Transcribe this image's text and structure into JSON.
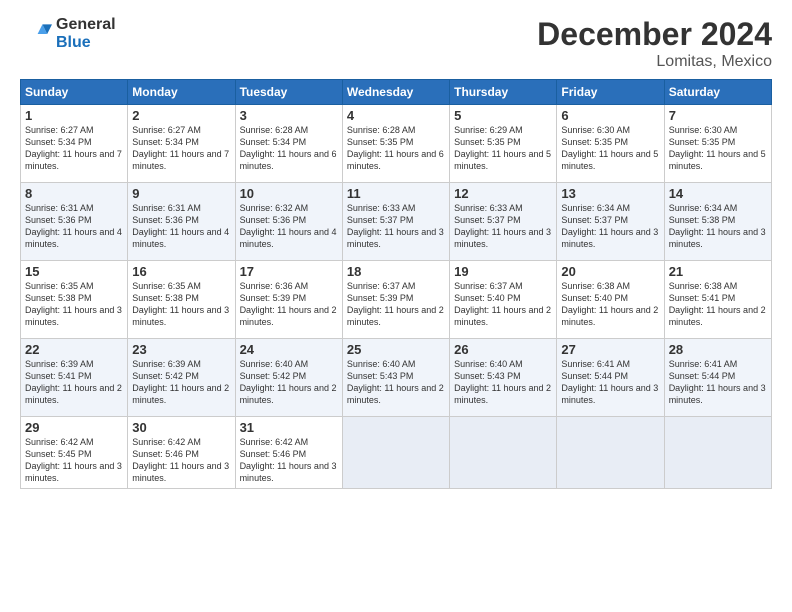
{
  "logo": {
    "general": "General",
    "blue": "Blue"
  },
  "title": "December 2024",
  "subtitle": "Lomitas, Mexico",
  "days_of_week": [
    "Sunday",
    "Monday",
    "Tuesday",
    "Wednesday",
    "Thursday",
    "Friday",
    "Saturday"
  ],
  "weeks": [
    [
      {
        "day": "1",
        "sunrise": "6:27 AM",
        "sunset": "5:34 PM",
        "daylight": "11 hours and 7 minutes."
      },
      {
        "day": "2",
        "sunrise": "6:27 AM",
        "sunset": "5:34 PM",
        "daylight": "11 hours and 7 minutes."
      },
      {
        "day": "3",
        "sunrise": "6:28 AM",
        "sunset": "5:34 PM",
        "daylight": "11 hours and 6 minutes."
      },
      {
        "day": "4",
        "sunrise": "6:28 AM",
        "sunset": "5:35 PM",
        "daylight": "11 hours and 6 minutes."
      },
      {
        "day": "5",
        "sunrise": "6:29 AM",
        "sunset": "5:35 PM",
        "daylight": "11 hours and 5 minutes."
      },
      {
        "day": "6",
        "sunrise": "6:30 AM",
        "sunset": "5:35 PM",
        "daylight": "11 hours and 5 minutes."
      },
      {
        "day": "7",
        "sunrise": "6:30 AM",
        "sunset": "5:35 PM",
        "daylight": "11 hours and 5 minutes."
      }
    ],
    [
      {
        "day": "8",
        "sunrise": "6:31 AM",
        "sunset": "5:36 PM",
        "daylight": "11 hours and 4 minutes."
      },
      {
        "day": "9",
        "sunrise": "6:31 AM",
        "sunset": "5:36 PM",
        "daylight": "11 hours and 4 minutes."
      },
      {
        "day": "10",
        "sunrise": "6:32 AM",
        "sunset": "5:36 PM",
        "daylight": "11 hours and 4 minutes."
      },
      {
        "day": "11",
        "sunrise": "6:33 AM",
        "sunset": "5:37 PM",
        "daylight": "11 hours and 3 minutes."
      },
      {
        "day": "12",
        "sunrise": "6:33 AM",
        "sunset": "5:37 PM",
        "daylight": "11 hours and 3 minutes."
      },
      {
        "day": "13",
        "sunrise": "6:34 AM",
        "sunset": "5:37 PM",
        "daylight": "11 hours and 3 minutes."
      },
      {
        "day": "14",
        "sunrise": "6:34 AM",
        "sunset": "5:38 PM",
        "daylight": "11 hours and 3 minutes."
      }
    ],
    [
      {
        "day": "15",
        "sunrise": "6:35 AM",
        "sunset": "5:38 PM",
        "daylight": "11 hours and 3 minutes."
      },
      {
        "day": "16",
        "sunrise": "6:35 AM",
        "sunset": "5:38 PM",
        "daylight": "11 hours and 3 minutes."
      },
      {
        "day": "17",
        "sunrise": "6:36 AM",
        "sunset": "5:39 PM",
        "daylight": "11 hours and 2 minutes."
      },
      {
        "day": "18",
        "sunrise": "6:37 AM",
        "sunset": "5:39 PM",
        "daylight": "11 hours and 2 minutes."
      },
      {
        "day": "19",
        "sunrise": "6:37 AM",
        "sunset": "5:40 PM",
        "daylight": "11 hours and 2 minutes."
      },
      {
        "day": "20",
        "sunrise": "6:38 AM",
        "sunset": "5:40 PM",
        "daylight": "11 hours and 2 minutes."
      },
      {
        "day": "21",
        "sunrise": "6:38 AM",
        "sunset": "5:41 PM",
        "daylight": "11 hours and 2 minutes."
      }
    ],
    [
      {
        "day": "22",
        "sunrise": "6:39 AM",
        "sunset": "5:41 PM",
        "daylight": "11 hours and 2 minutes."
      },
      {
        "day": "23",
        "sunrise": "6:39 AM",
        "sunset": "5:42 PM",
        "daylight": "11 hours and 2 minutes."
      },
      {
        "day": "24",
        "sunrise": "6:40 AM",
        "sunset": "5:42 PM",
        "daylight": "11 hours and 2 minutes."
      },
      {
        "day": "25",
        "sunrise": "6:40 AM",
        "sunset": "5:43 PM",
        "daylight": "11 hours and 2 minutes."
      },
      {
        "day": "26",
        "sunrise": "6:40 AM",
        "sunset": "5:43 PM",
        "daylight": "11 hours and 2 minutes."
      },
      {
        "day": "27",
        "sunrise": "6:41 AM",
        "sunset": "5:44 PM",
        "daylight": "11 hours and 3 minutes."
      },
      {
        "day": "28",
        "sunrise": "6:41 AM",
        "sunset": "5:44 PM",
        "daylight": "11 hours and 3 minutes."
      }
    ],
    [
      {
        "day": "29",
        "sunrise": "6:42 AM",
        "sunset": "5:45 PM",
        "daylight": "11 hours and 3 minutes."
      },
      {
        "day": "30",
        "sunrise": "6:42 AM",
        "sunset": "5:46 PM",
        "daylight": "11 hours and 3 minutes."
      },
      {
        "day": "31",
        "sunrise": "6:42 AM",
        "sunset": "5:46 PM",
        "daylight": "11 hours and 3 minutes."
      },
      null,
      null,
      null,
      null
    ]
  ]
}
